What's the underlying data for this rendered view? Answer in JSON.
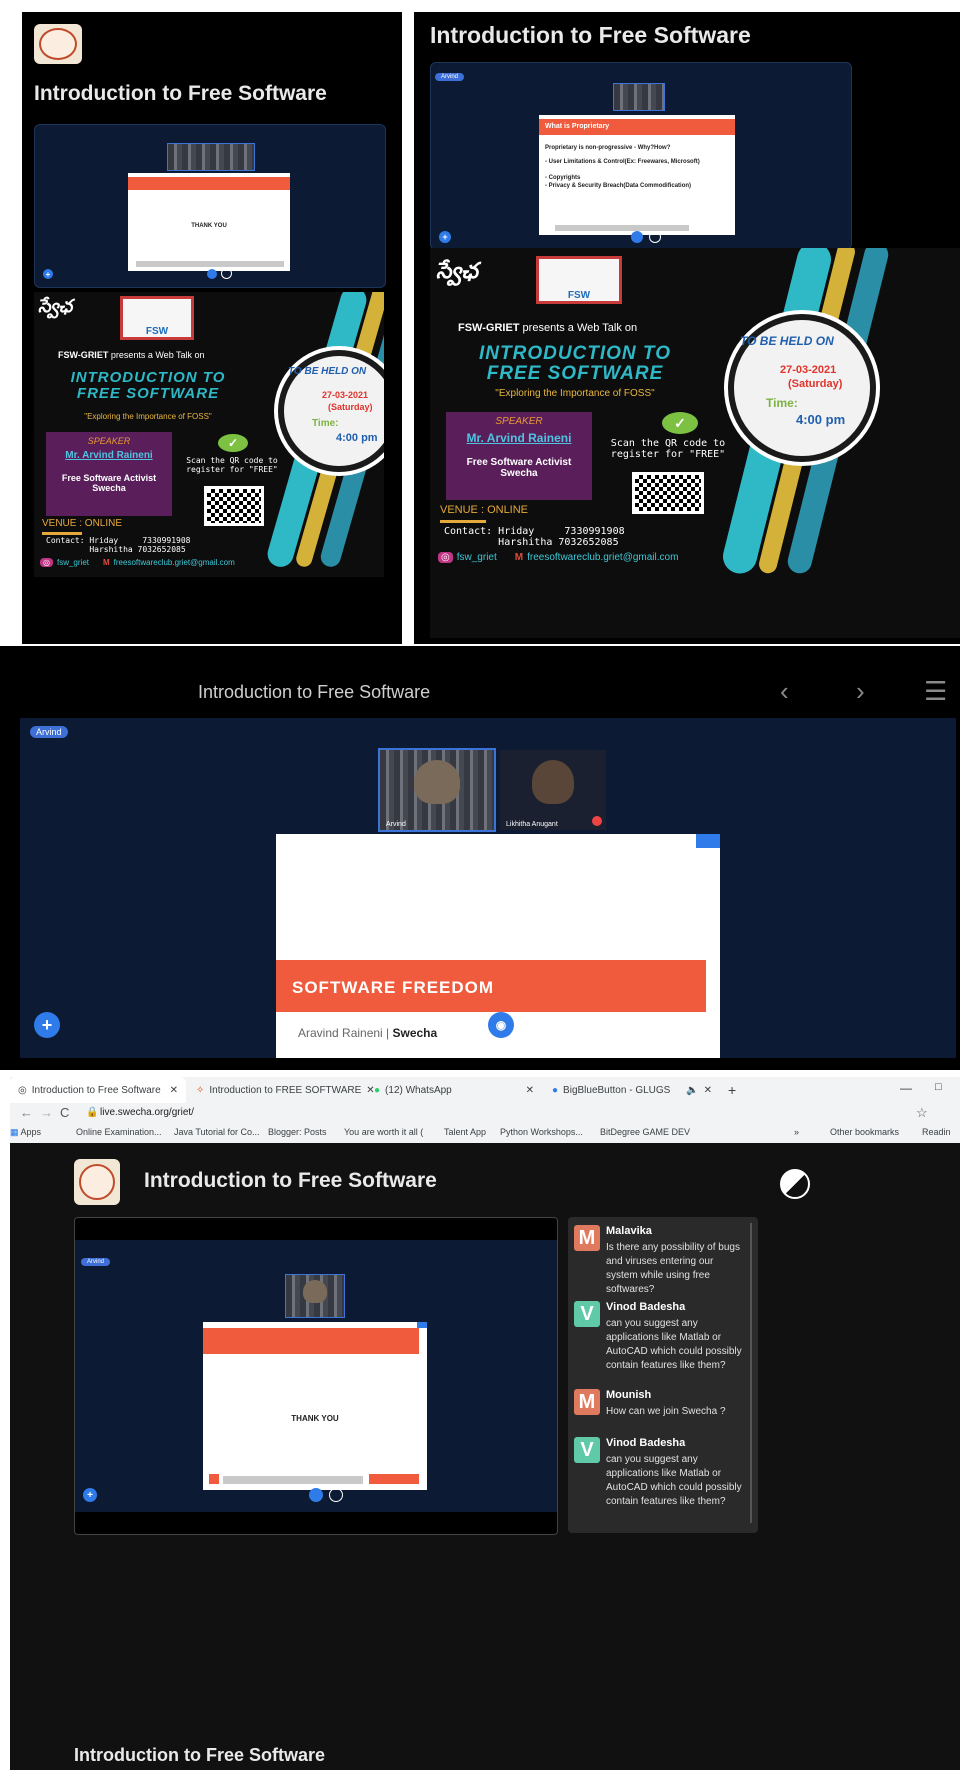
{
  "colors": {
    "accent_red": "#ef5b3c",
    "meeting_bg": "#0c1b33",
    "bbb_blue": "#2f7bea",
    "poster_teal": "#2fb8c6",
    "poster_purple": "#5a1f5b"
  },
  "panel1": {
    "title": "Introduction to Free Software",
    "slide_text": "THANK YOU",
    "poster": {
      "telugu": "స్వేఛ",
      "fsw": "FSW",
      "presents_bold": "FSW-GRIET",
      "presents_rest": " presents a Web Talk on",
      "title_line1": "INTRODUCTION TO",
      "title_line2": "FREE SOFTWARE",
      "tagline": "\"Exploring the Importance of FOSS\"",
      "speaker_label": "SPEAKER",
      "speaker_name": "Mr. Arvind Raineni",
      "speaker_role": "Free Software Activist",
      "speaker_org": "Swecha",
      "scan_text": "Scan the QR code to register for \"FREE\"",
      "venue": "VENUE : ONLINE",
      "contact": "Contact: Hriday     7330991908\n         Harshitha 7032652085",
      "instagram": "fsw_griet",
      "email": "freesoftwareclub.griet@gmail.com",
      "held_on": "TO BE HELD ON",
      "date": "27-03-2021",
      "day": "(Saturday)",
      "time_label": "Time:",
      "time": "4:00 pm"
    }
  },
  "panel2": {
    "title": "Introduction to Free Software",
    "slide": {
      "heading": "What is Proprietary",
      "line1": "Proprietary is non-progressive - Why?How?",
      "bullet1": "- User Limitations & Control(Ex: Freewares, Microsoft)",
      "bullet2": "-  Copyrights",
      "bullet3": "-  Privacy & Security Breach(Data Commodification)"
    }
  },
  "panel3": {
    "nav_title": "Introduction to Free Software",
    "badge": "Arvind",
    "video1_label": "Arvind",
    "video2_label": "Likhitha Anugant",
    "slide_title": "SOFTWARE FREEDOM",
    "slide_author": "Aravind Raineni | ",
    "slide_org": "Swecha"
  },
  "browser": {
    "tabs": [
      {
        "label": "Introduction to Free Software",
        "icon": "globe-icon"
      },
      {
        "label": "Introduction to FREE SOFTWARE",
        "icon": "ubuntu-icon"
      },
      {
        "label": "(12) WhatsApp",
        "icon": "whatsapp-icon"
      },
      {
        "label": "BigBlueButton - GLUGS",
        "icon": "bbb-icon"
      }
    ],
    "url": "live.swecha.org/griet/",
    "bookmarks": [
      "Apps",
      "Online Examination...",
      "Java Tutorial for Co...",
      "Blogger: Posts",
      "You are worth it all (",
      "Talent App",
      "Python Workshops...",
      "BitDegree GAME DEV"
    ],
    "other_bookmarks": "Other bookmarks",
    "reading_list": "Readin",
    "page_title": "Introduction to Free Software",
    "slide_text": "THANK YOU",
    "badge": "Arvind",
    "bottom_title": "Introduction to Free Software",
    "chat": [
      {
        "initial": "M",
        "name": "Malavika",
        "text": "Is there any possibility of bugs and viruses entering our system while using free softwares?",
        "color": "#e07a5f"
      },
      {
        "initial": "V",
        "name": "Vinod Badesha",
        "text": "can you suggest any applications like Matlab or AutoCAD which could possibly contain features like them?",
        "color": "#5fc9a8"
      },
      {
        "initial": "M",
        "name": "Mounish",
        "text": "How can we join Swecha ?",
        "color": "#e07a5f"
      },
      {
        "initial": "V",
        "name": "Vinod Badesha",
        "text": "can you suggest any applications like Matlab or AutoCAD which could possibly contain features like them?",
        "color": "#5fc9a8"
      }
    ]
  }
}
